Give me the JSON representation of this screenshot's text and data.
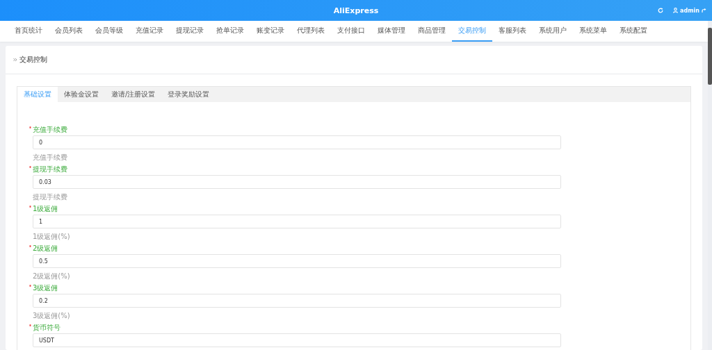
{
  "header": {
    "title": "AliExpress",
    "user": "admin"
  },
  "nav": [
    {
      "label": "首页统计",
      "selected": false
    },
    {
      "label": "会员列表",
      "selected": false
    },
    {
      "label": "会员等级",
      "selected": false
    },
    {
      "label": "充值记录",
      "selected": false
    },
    {
      "label": "提现记录",
      "selected": false
    },
    {
      "label": "抢单记录",
      "selected": false
    },
    {
      "label": "账变记录",
      "selected": false
    },
    {
      "label": "代理列表",
      "selected": false
    },
    {
      "label": "支付接口",
      "selected": false
    },
    {
      "label": "媒体管理",
      "selected": false
    },
    {
      "label": "商品管理",
      "selected": false
    },
    {
      "label": "交易控制",
      "selected": true
    },
    {
      "label": "客服列表",
      "selected": false
    },
    {
      "label": "系统用户",
      "selected": false
    },
    {
      "label": "系统菜单",
      "selected": false
    },
    {
      "label": "系统配置",
      "selected": false
    }
  ],
  "breadcrumb": "交易控制",
  "tabs": [
    {
      "label": "基础设置",
      "selected": true
    },
    {
      "label": "体验金设置",
      "selected": false
    },
    {
      "label": "邀请/注册设置",
      "selected": false
    },
    {
      "label": "登录奖励设置",
      "selected": false
    }
  ],
  "fields": [
    {
      "label": "充值手续费",
      "required": true,
      "value": "0",
      "help": "充值手续费"
    },
    {
      "label": "提现手续费",
      "required": true,
      "value": "0.03",
      "help": "提现手续费"
    },
    {
      "label": "1级返佣",
      "required": true,
      "value": "1",
      "help": "1级返佣(%)"
    },
    {
      "label": "2级返佣",
      "required": true,
      "value": "0.5",
      "help": "2级返佣(%)"
    },
    {
      "label": "3级返佣",
      "required": true,
      "value": "0.2",
      "help": "3级返佣(%)"
    },
    {
      "label": "货币符号",
      "required": true,
      "value": "USDT"
    }
  ]
}
